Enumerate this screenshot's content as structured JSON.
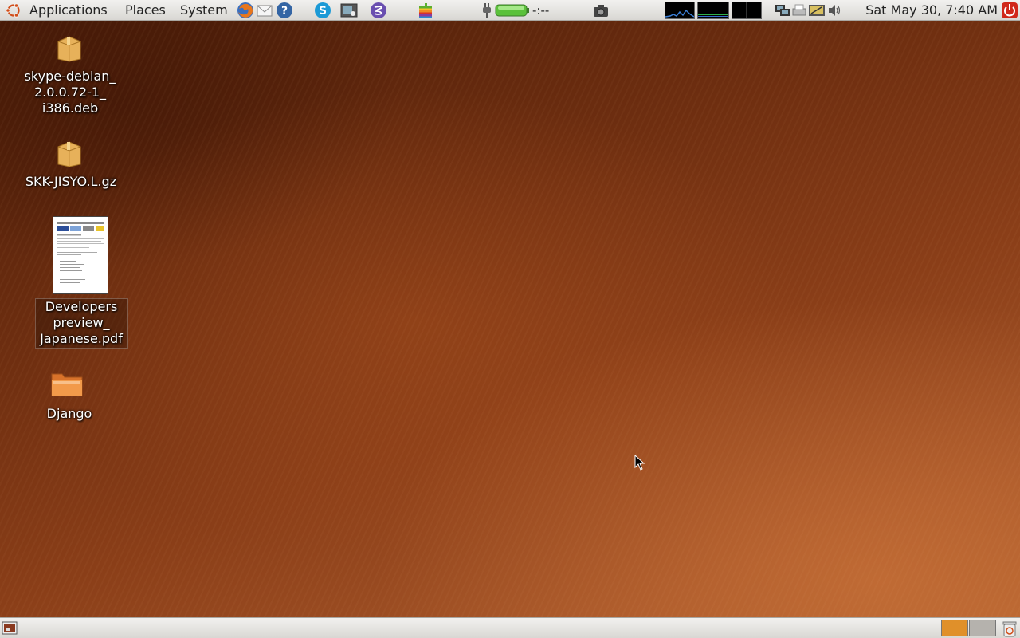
{
  "top_panel": {
    "menus": {
      "applications": "Applications",
      "places": "Places",
      "system": "System"
    },
    "launchers": [
      "firefox-icon",
      "mail-icon",
      "help-icon",
      "skype-icon",
      "screenshot-app-icon",
      "emacs-icon",
      "apple-icon"
    ],
    "battery_text": "-:--",
    "clock": "Sat May 30,  7:40 AM"
  },
  "desktop": {
    "icons": [
      {
        "label_lines": [
          "skype-debian_",
          "2.0.0.72-1_",
          "i386.deb"
        ],
        "kind": "package-icon"
      },
      {
        "label_lines": [
          "SKK-JISYO.L.gz"
        ],
        "kind": "package-icon"
      },
      {
        "label_lines": [
          "Developers",
          "preview_",
          "Japanese.pdf"
        ],
        "kind": "pdf-thumbnail-icon"
      },
      {
        "label_lines": [
          "Django"
        ],
        "kind": "folder-icon"
      }
    ]
  },
  "colors": {
    "panel_bg": "#e6e4e0",
    "workspace_active": "#e0902a",
    "workspace_inactive": "#b5b2ad"
  }
}
